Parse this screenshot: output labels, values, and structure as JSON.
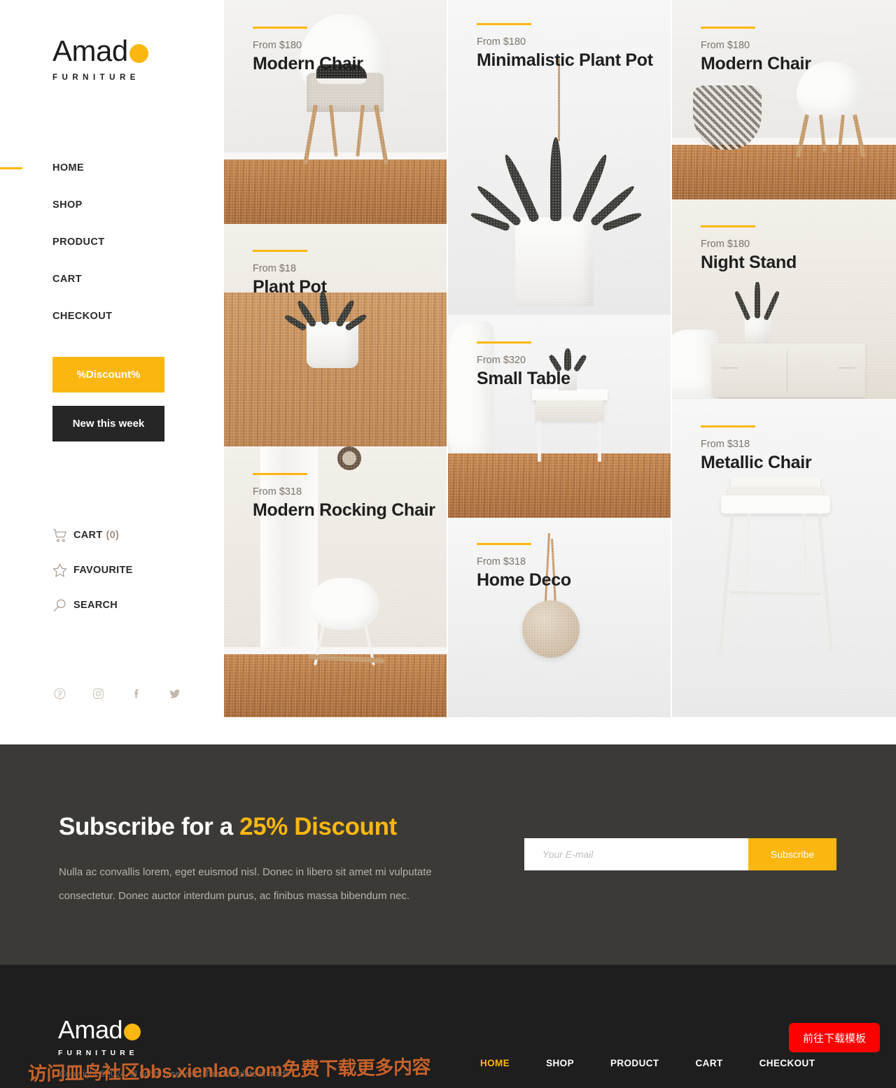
{
  "brand": {
    "name": "Amad",
    "dot": "o",
    "tagline": "FURNITURE"
  },
  "sidebar": {
    "nav": [
      {
        "label": "HOME",
        "active": true
      },
      {
        "label": "SHOP",
        "active": false
      },
      {
        "label": "PRODUCT",
        "active": false
      },
      {
        "label": "CART",
        "active": false
      },
      {
        "label": "CHECKOUT",
        "active": false
      }
    ],
    "buttons": {
      "discount": "%Discount%",
      "new": "New this week"
    },
    "utils": [
      {
        "icon": "cart-icon",
        "label": "CART",
        "count": "(0)"
      },
      {
        "icon": "star-icon",
        "label": "FAVOURITE",
        "count": ""
      },
      {
        "icon": "search-icon",
        "label": "SEARCH",
        "count": ""
      }
    ],
    "social": [
      "pinterest-icon",
      "instagram-icon",
      "facebook-icon",
      "twitter-icon"
    ]
  },
  "products": [
    {
      "price": "From $180",
      "title": "Modern Chair"
    },
    {
      "price": "From $18",
      "title": "Plant Pot"
    },
    {
      "price": "From $318",
      "title": "Modern Rocking Chair"
    },
    {
      "price": "From $180",
      "title": "Minimalistic Plant Pot"
    },
    {
      "price": "From $320",
      "title": "Small Table"
    },
    {
      "price": "From $318",
      "title": "Home Deco"
    },
    {
      "price": "From $180",
      "title": "Modern Chair"
    },
    {
      "price": "From $180",
      "title": "Night Stand"
    },
    {
      "price": "From $318",
      "title": "Metallic Chair"
    }
  ],
  "subscribe": {
    "head_plain": "Subscribe for a ",
    "head_accent": "25% Discount",
    "body": "Nulla ac convallis lorem, eget euismod nisl. Donec in libero sit amet mi vulputate consectetur. Donec auctor interdum purus, ac finibus massa bibendum nec.",
    "placeholder": "Your E-mail",
    "button": "Subscribe"
  },
  "footer": {
    "copyright": "Copyright ©2024 All rights reserved | This template is made",
    "nav": [
      {
        "label": "HOME",
        "active": true
      },
      {
        "label": "SHOP",
        "active": false
      },
      {
        "label": "PRODUCT",
        "active": false
      },
      {
        "label": "CART",
        "active": false
      },
      {
        "label": "CHECKOUT",
        "active": false
      }
    ],
    "download_button": "前往下载模板",
    "watermark": "访问皿鸟社区bbs.xienlao.com免费下载更多内容"
  },
  "colors": {
    "accent": "#fbb710",
    "dark": "#1e1e1e",
    "subscribe_bg": "#3b3a37",
    "download": "#fd0000"
  }
}
